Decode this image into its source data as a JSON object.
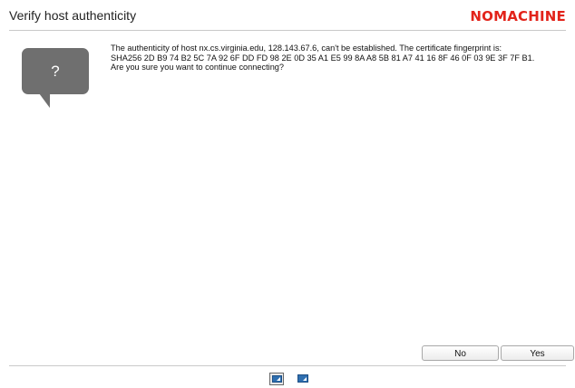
{
  "window": {
    "title": "Verify host authenticity",
    "logo_text": "NOMACHINE",
    "logo_color": "#e2231a"
  },
  "dialog": {
    "icon": "question-mark-speech-bubble-icon",
    "icon_glyph": "?",
    "message_lines": [
      "The authenticity of host nx.cs.virginia.edu, 128.143.67.6, can't be established. The certificate fingerprint is:",
      "SHA256 2D B9 74 B2 5C 7A 92 6F DD FD 98 2E 0D 35 A1 E5 99 8A A8 5B 81 A7 41 16 8F 46 0F 03 9E 3F 7F B1.",
      "Are you sure you want to continue connecting?"
    ]
  },
  "buttons": {
    "no_label": "No",
    "yes_label": "Yes"
  },
  "bottom_bar": {
    "icons": [
      "display-icon-selected",
      "display-icon"
    ]
  }
}
